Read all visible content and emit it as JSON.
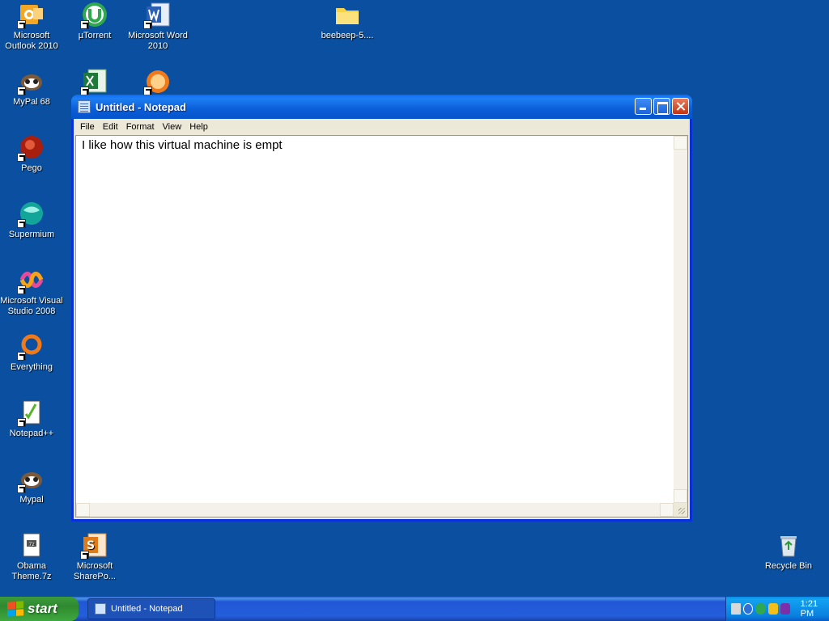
{
  "desktop": {
    "icons": [
      {
        "label": "Microsoft Outlook 2010"
      },
      {
        "label": "µTorrent"
      },
      {
        "label": "Microsoft Word 2010"
      },
      {
        "label": "beebeep-5...."
      },
      {
        "label": "MyPal 68"
      },
      {
        "label": "Pego"
      },
      {
        "label": "Supermium"
      },
      {
        "label": "Microsoft Visual Studio 2008"
      },
      {
        "label": "Everything"
      },
      {
        "label": "Notepad++"
      },
      {
        "label": "Mypal"
      },
      {
        "label": "Obama Theme.7z"
      },
      {
        "label": "Microsoft SharePo..."
      },
      {
        "label": "Recycle Bin"
      }
    ]
  },
  "window": {
    "title": "Untitled - Notepad",
    "menu": [
      "File",
      "Edit",
      "Format",
      "View",
      "Help"
    ],
    "content": "I like how this virtual machine is empt"
  },
  "taskbar": {
    "start_label": "start",
    "task_label": "Untitled - Notepad",
    "clock": "1:21 PM"
  }
}
